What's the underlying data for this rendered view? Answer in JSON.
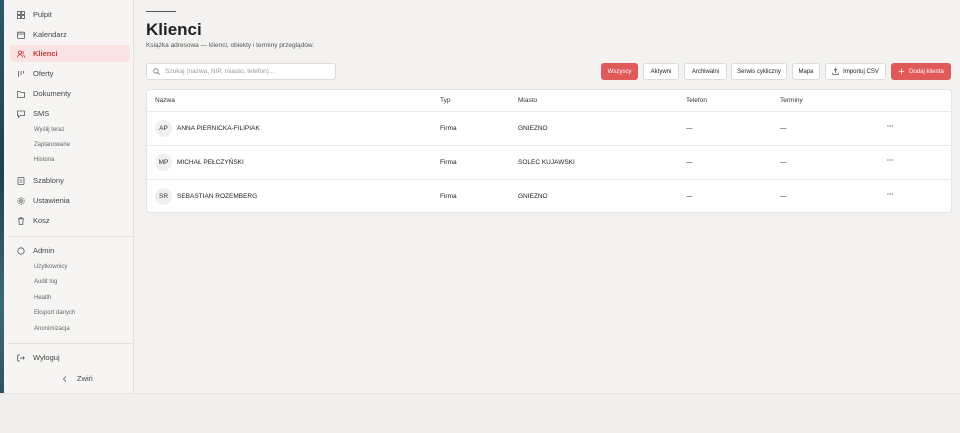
{
  "sidebar": {
    "items": [
      {
        "label": "Pulpit",
        "icon": "grid-icon"
      },
      {
        "label": "Kalendarz",
        "icon": "calendar-icon"
      },
      {
        "label": "Klienci",
        "icon": "users-icon"
      },
      {
        "label": "Oferty",
        "icon": "offers-icon"
      },
      {
        "label": "Dokumenty",
        "icon": "folder-icon"
      },
      {
        "label": "SMS",
        "icon": "message-icon"
      }
    ],
    "sms_subitems": [
      "Wyślij teraz",
      "Zaplanowane",
      "Historia"
    ],
    "items2": [
      {
        "label": "Szablony",
        "icon": "template-icon"
      },
      {
        "label": "Ustawienia",
        "icon": "gear-icon"
      },
      {
        "label": "Kosz",
        "icon": "trash-icon"
      }
    ],
    "admin_label": "Admin",
    "admin_subitems": [
      "Użytkownicy",
      "Audit log",
      "Health",
      "Eksport danych",
      "Anonimizacja"
    ],
    "logout_label": "Wyloguj",
    "collapse_label": "Zwiń"
  },
  "header": {
    "title": "Klienci",
    "subtitle": "Książka adresowa — klienci, obiekty i terminy przeglądów."
  },
  "toolbar": {
    "search_placeholder": "Szukaj (nazwa, NIP, miasto, telefon)...",
    "filters": [
      "Wszyscy",
      "Aktywni",
      "Archiwalni",
      "Serwis cykliczny",
      "Mapa"
    ],
    "import_label": "Importuj CSV",
    "add_label": "Dodaj klienta"
  },
  "table": {
    "headers": [
      "Nazwa",
      "Typ",
      "Miasto",
      "Telefon",
      "Terminy"
    ],
    "rows": [
      {
        "initials": "AP",
        "name": "ANNA PIERNICKA-FILIPIAK",
        "type": "Firma",
        "city": "GNIEZNO",
        "phone": "—",
        "terms": "—",
        "actions": "···"
      },
      {
        "initials": "MP",
        "name": "MICHAŁ PEŁCZYŃSKI",
        "type": "Firma",
        "city": "SOLEC KUJAWSKI",
        "phone": "—",
        "terms": "—",
        "actions": "···"
      },
      {
        "initials": "SR",
        "name": "SEBASTIAN ROZEMBERG",
        "type": "Firma",
        "city": "GNIEZNO",
        "phone": "—",
        "terms": "—",
        "actions": "···"
      }
    ]
  },
  "colors": {
    "accent": "#e05a5a",
    "active_bg": "#fbe3e3",
    "active_text": "#c23a3a"
  }
}
